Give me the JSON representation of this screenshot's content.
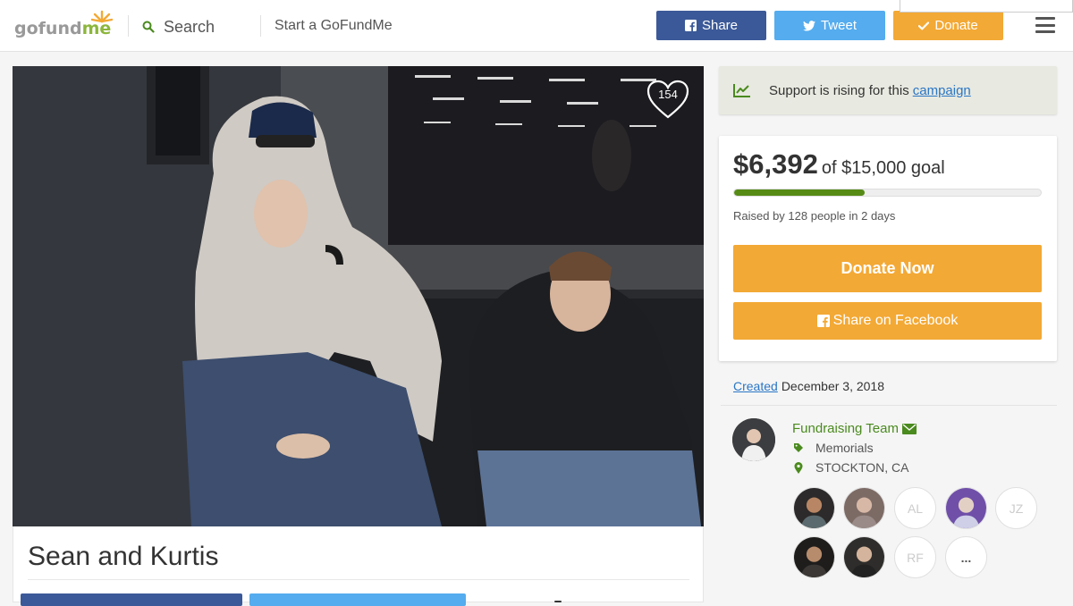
{
  "header": {
    "logo": {
      "gofund": "gofund",
      "me": "me"
    },
    "search_label": "Search",
    "start_label": "Start a GoFundMe",
    "share_label": "Share",
    "tweet_label": "Tweet",
    "donate_label": "Donate"
  },
  "campaign": {
    "title": "Sean and Kurtis",
    "heart_count": "154"
  },
  "sidebar": {
    "rising_text": "Support is rising for this",
    "rising_link": "campaign",
    "amount_raised": "$6,392",
    "goal_text": "of $15,000 goal",
    "progress_fraction": 0.426,
    "raised_text": "Raised by 128 people in 2 days",
    "donate_now_label": "Donate Now",
    "share_facebook_label": "Share on Facebook",
    "created_link": "Created",
    "created_date": "December 3, 2018",
    "organizer_label": "Fundraising Team",
    "category": "Memorials",
    "location": "STOCKTON, CA",
    "donors": [
      {
        "kind": "photo",
        "initials": ""
      },
      {
        "kind": "photo",
        "initials": ""
      },
      {
        "kind": "initials",
        "initials": "AL"
      },
      {
        "kind": "photo",
        "initials": ""
      },
      {
        "kind": "initials",
        "initials": "JZ"
      },
      {
        "kind": "photo",
        "initials": ""
      },
      {
        "kind": "photo",
        "initials": ""
      },
      {
        "kind": "initials",
        "initials": "RF"
      },
      {
        "kind": "more",
        "initials": "..."
      }
    ]
  },
  "colors": {
    "facebook": "#3b5998",
    "twitter": "#55acee",
    "donate": "#f3a935",
    "progress": "#568b16",
    "link": "#2a76c6",
    "brand_green": "#8cb63c"
  }
}
